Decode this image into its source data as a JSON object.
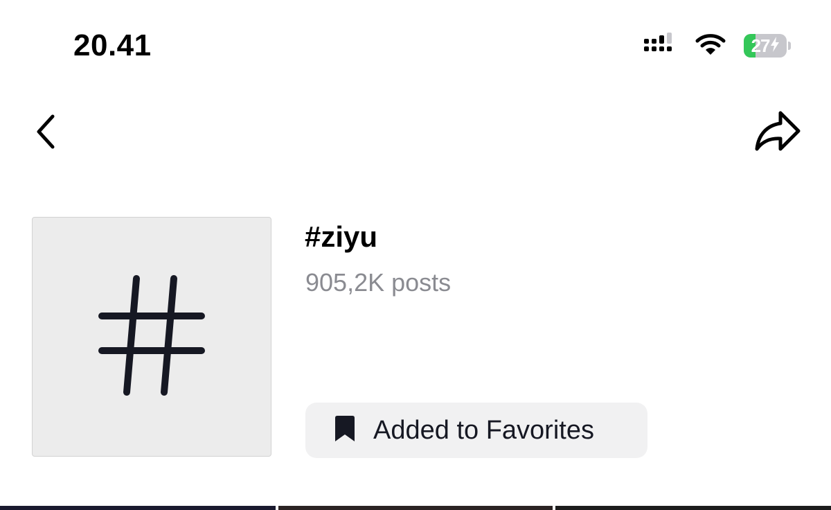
{
  "status_bar": {
    "time": "20.41",
    "battery_level": "27",
    "battery_fraction": 0.27
  },
  "nav": {
    "back_icon": "chevron-left-icon",
    "share_icon": "share-arrow-icon"
  },
  "hashtag": {
    "title": "#ziyu",
    "post_count": "905,2K posts",
    "cover_icon": "hashtag-icon"
  },
  "favorite": {
    "label": "Added to Favorites",
    "icon": "bookmark-icon"
  },
  "colors": {
    "text_primary": "#161823",
    "text_secondary": "#8a8b91",
    "button_bg": "#f1f1f2",
    "cover_bg": "#ececec",
    "battery_green": "#34c759"
  },
  "thumbnails": [
    {
      "color": "#1a1a2e"
    },
    {
      "color": "#2b2323"
    },
    {
      "color": "#1c1c1c"
    }
  ]
}
